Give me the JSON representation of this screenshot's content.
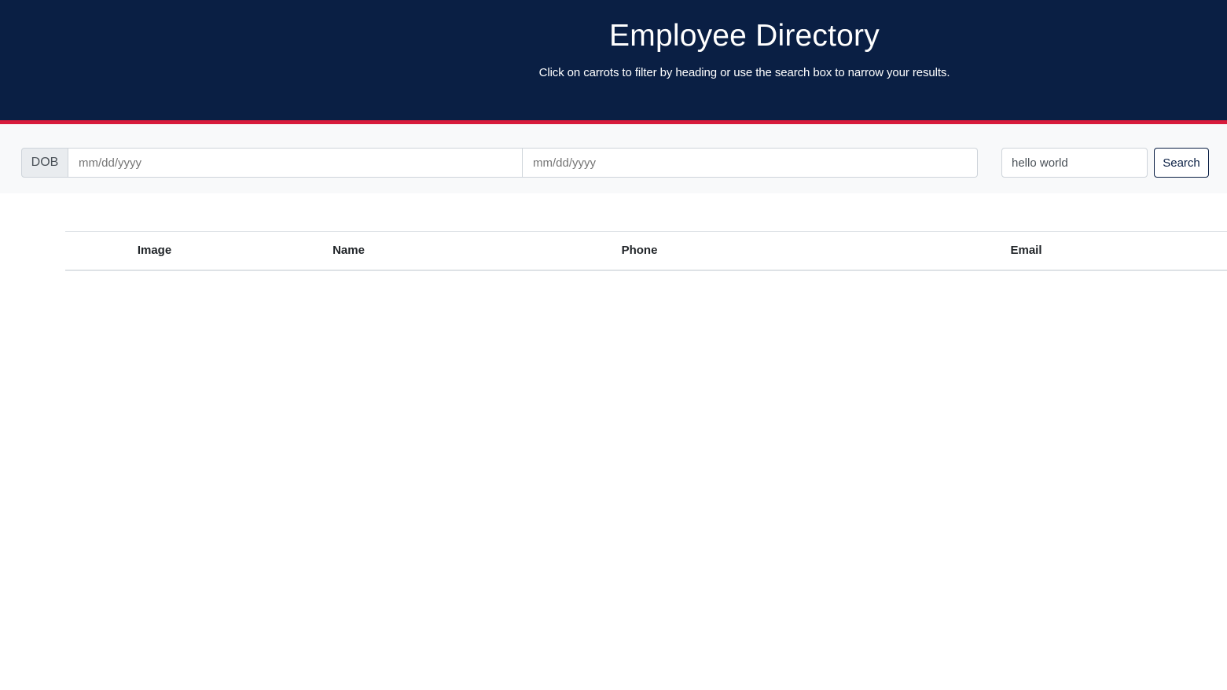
{
  "header": {
    "title": "Employee Directory",
    "subtitle": "Click on carrots to filter by heading or use the search box to narrow your results."
  },
  "filters": {
    "dob_label": "DOB",
    "start_date_placeholder": "mm/dd/yyyy",
    "end_date_placeholder": "mm/dd/yyyy",
    "search_value": "hello world",
    "search_button_label": "Search"
  },
  "table": {
    "columns": [
      "Image",
      "Name",
      "Phone",
      "Email"
    ],
    "rows": []
  },
  "colors": {
    "header_bg": "#0a1f44",
    "accent": "#d81b3c",
    "toolbar_bg": "#f8f9fa"
  }
}
